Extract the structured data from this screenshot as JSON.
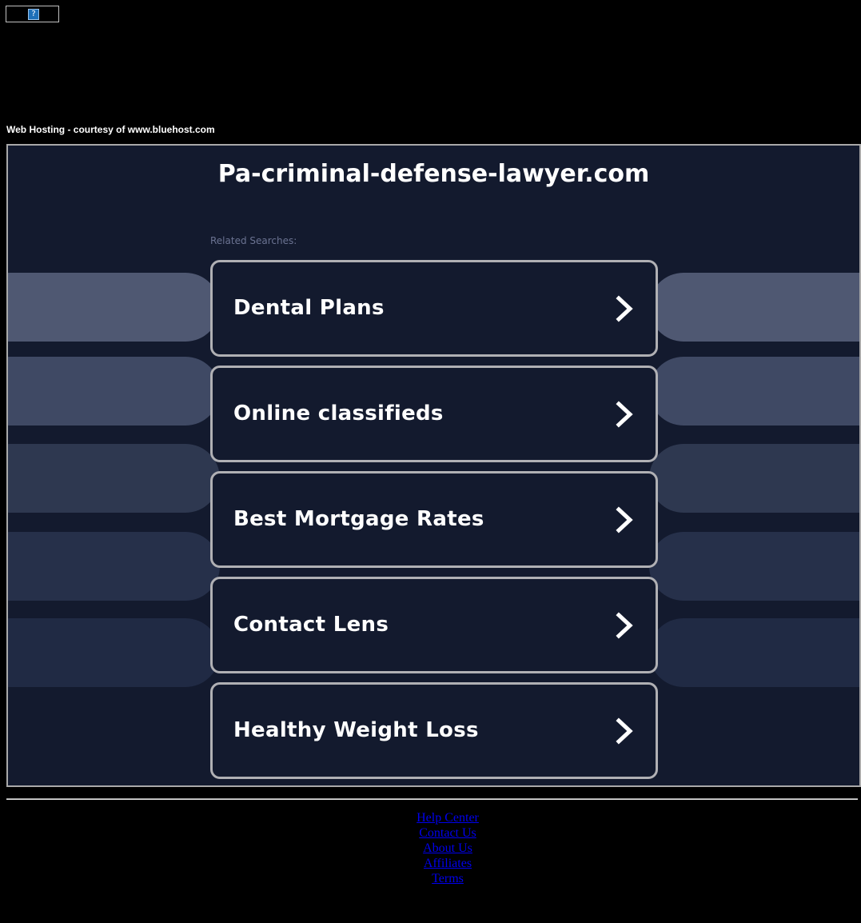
{
  "banner": {
    "icon": "broken-image-icon",
    "glyph": "?"
  },
  "hosting_credit": "Web Hosting - courtesy of www.bluehost.com",
  "site_title": "Pa-criminal-defense-lawyer.com",
  "related_label": "Related Searches:",
  "searches": [
    {
      "label": "Dental Plans"
    },
    {
      "label": "Online classifieds"
    },
    {
      "label": "Best Mortgage Rates"
    },
    {
      "label": "Contact Lens"
    },
    {
      "label": "Healthy Weight Loss"
    }
  ],
  "footer_links": [
    {
      "label": "Help Center"
    },
    {
      "label": "Contact Us"
    },
    {
      "label": "About Us"
    },
    {
      "label": "Affiliates"
    },
    {
      "label": "Terms"
    }
  ],
  "colors": {
    "page_bg": "#000000",
    "frame_bg": "#131a2e",
    "link_border": "#b0b0b4",
    "footer_link": "#0000ee"
  }
}
